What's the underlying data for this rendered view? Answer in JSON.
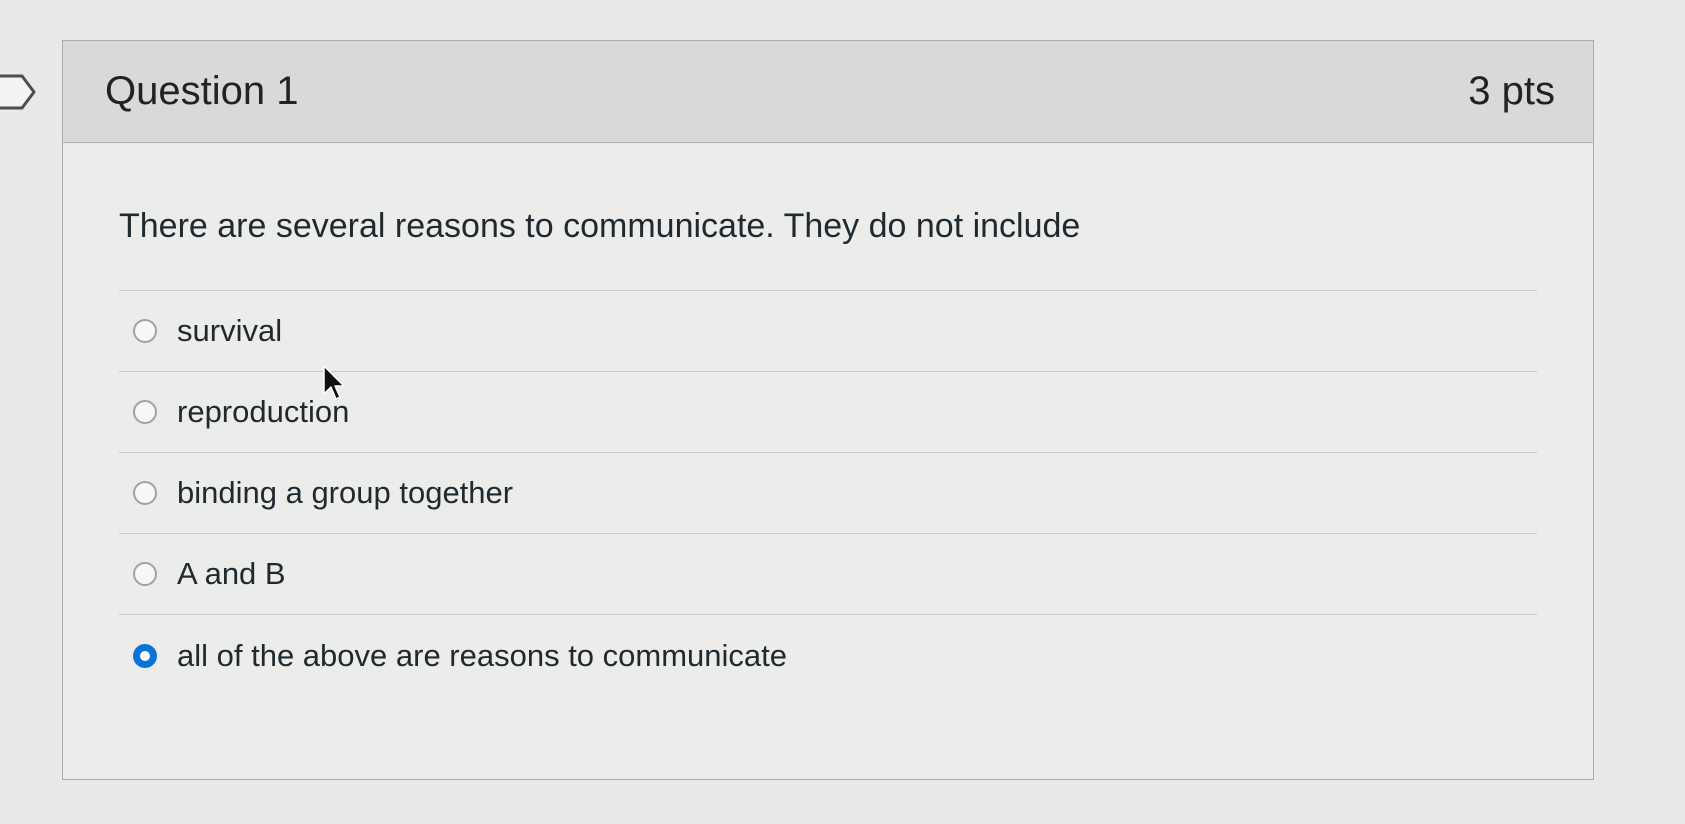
{
  "question": {
    "title": "Question 1",
    "points": "3 pts",
    "text": "There are several reasons to communicate.  They do not include",
    "answers": [
      {
        "label": "survival",
        "selected": false
      },
      {
        "label": "reproduction",
        "selected": false
      },
      {
        "label": "binding a group together",
        "selected": false
      },
      {
        "label": "A and B",
        "selected": false
      },
      {
        "label": "all of the above are reasons to communicate",
        "selected": true
      }
    ]
  },
  "colors": {
    "selected_radio": "#0a74d6",
    "header_bg": "#d9d9d7",
    "body_bg": "#ececea"
  },
  "icons": {
    "flag": "flag-outline-icon",
    "cursor": "mouse-pointer-icon"
  }
}
